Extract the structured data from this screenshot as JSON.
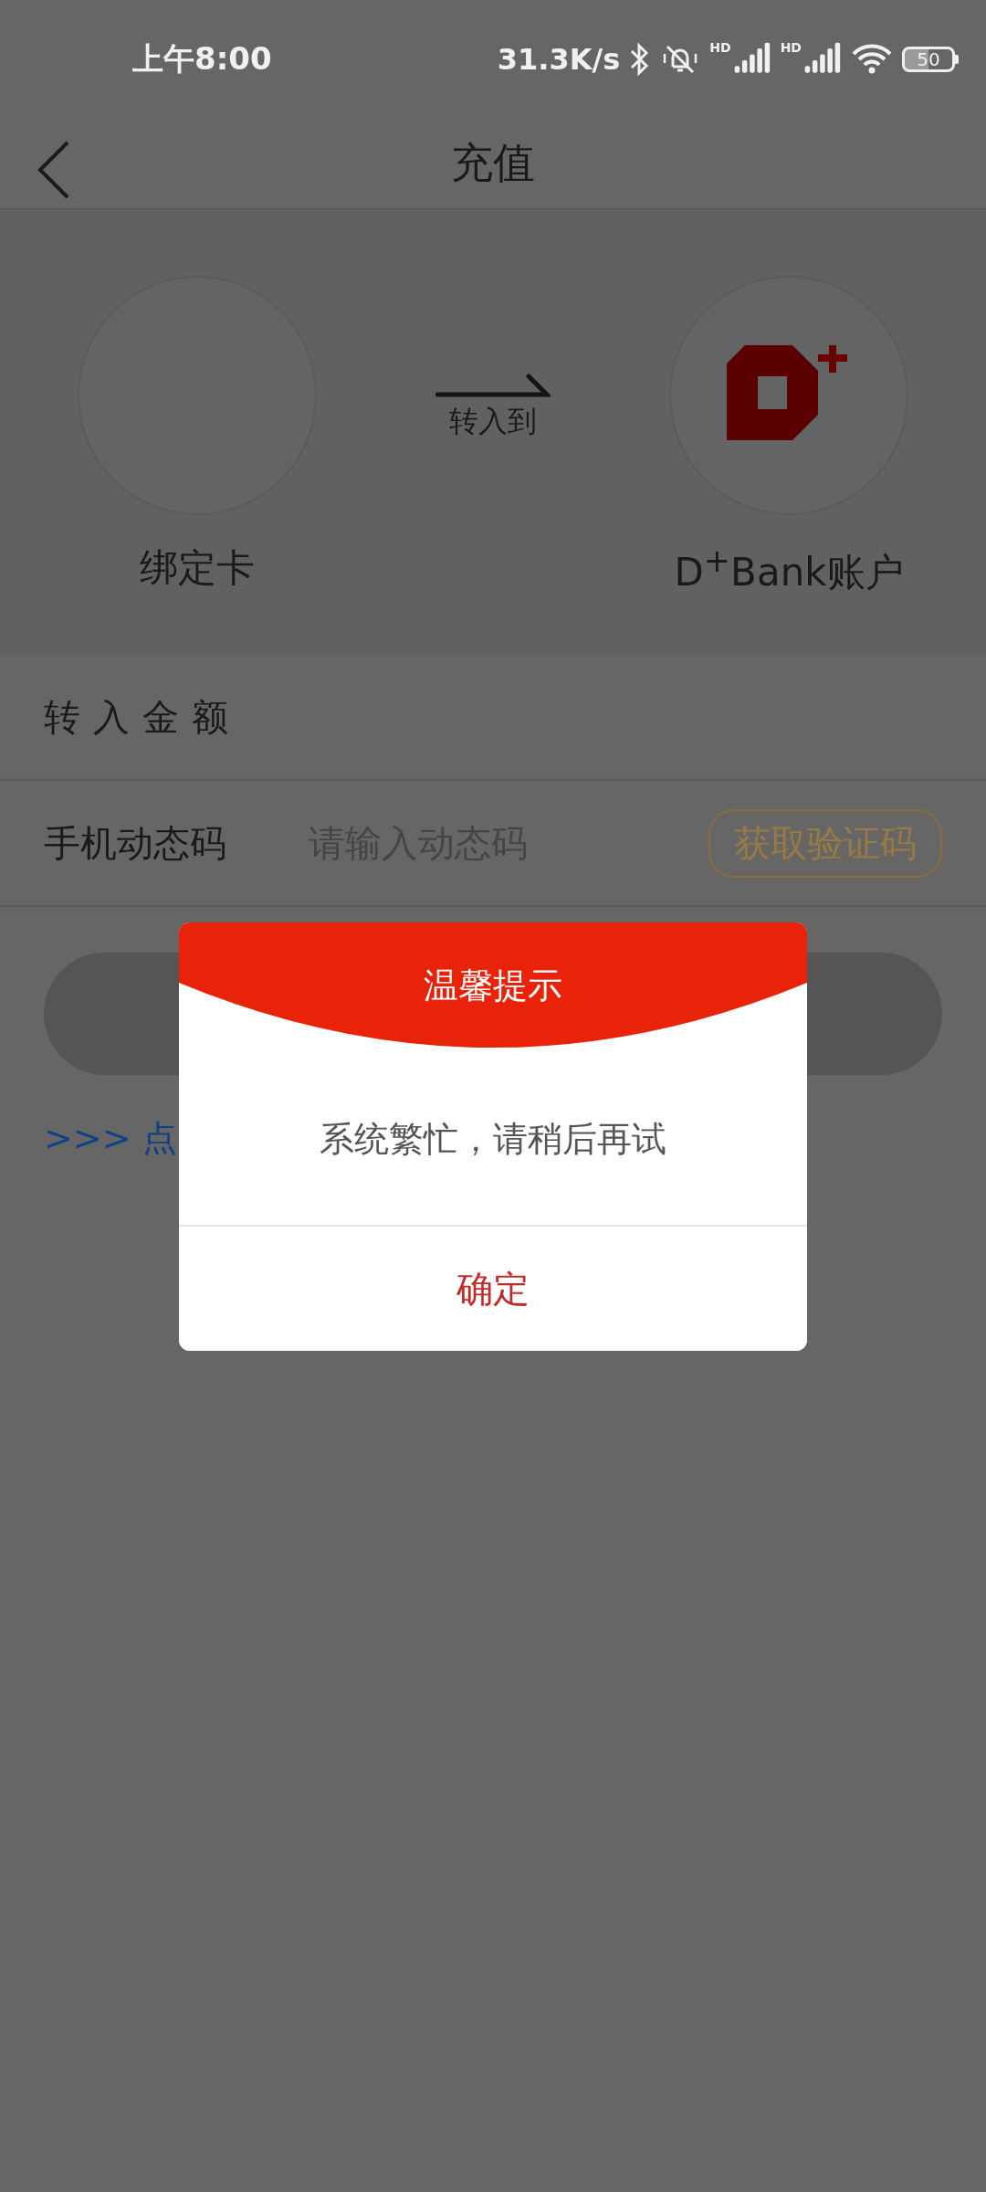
{
  "status_bar": {
    "time": "上午8:00",
    "net_speed": "31.3K/s",
    "signals": [
      {
        "label": "HD"
      },
      {
        "label": "HD"
      }
    ],
    "battery": "50"
  },
  "header": {
    "title": "充值"
  },
  "transfer": {
    "from": {
      "label": "绑定卡"
    },
    "arrow_label": "转入到",
    "to": {
      "label": "D$^{+}$Bank账户"
    }
  },
  "form": {
    "amount": {
      "label": "转入金额"
    },
    "code": {
      "label": "手机动态码",
      "placeholder": "请输入动态码",
      "button": "获取验证码"
    }
  },
  "link": {
    "text": ">>> 点"
  },
  "dialog": {
    "title": "温馨提示",
    "message": "系统繁忙，请稍后再试",
    "button": "确定"
  }
}
